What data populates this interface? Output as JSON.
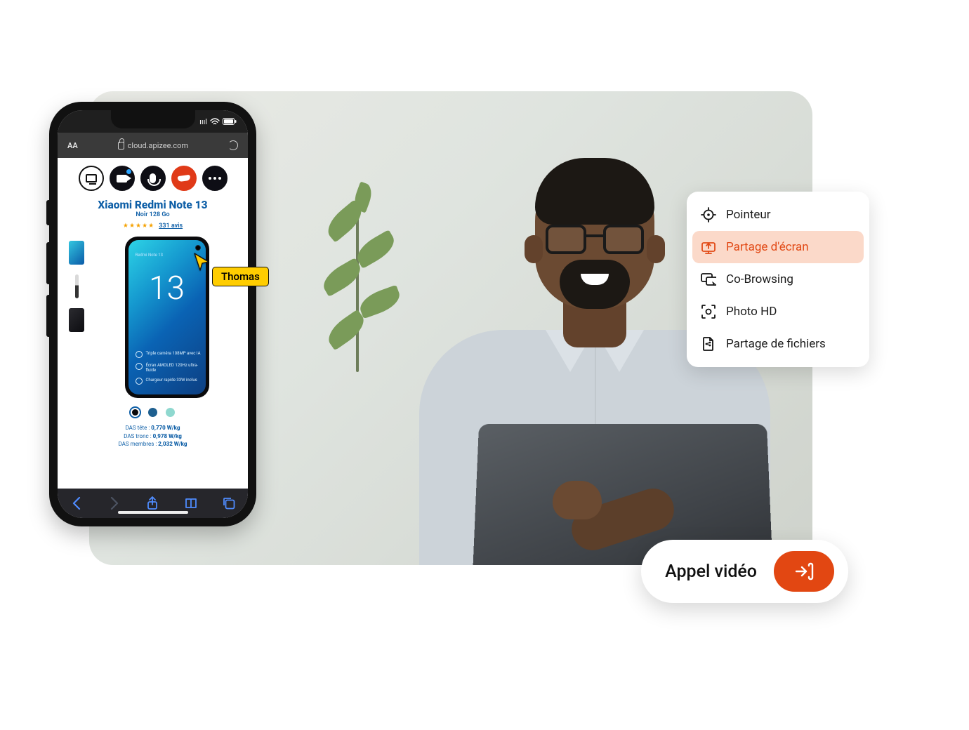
{
  "phone": {
    "status": {
      "signal": "ıııl",
      "wifi": "􀙇",
      "battery": "􀛨"
    },
    "address": {
      "aA": "AA",
      "url": "cloud.apizee.com"
    },
    "product": {
      "title": "Xiaomi Redmi Note 13",
      "subtitle": "Noir 128 Go",
      "reviews_link": "331 avis",
      "image_badge_mini": "Redmi Note 13",
      "image_badge_big": "13",
      "features": [
        "Triple caméra 108MP avec IA",
        "Écran AMOLED 120Hz ultra-fluide",
        "Chargeur rapide 33W inclus"
      ],
      "swatches": [
        {
          "color": "#0a0a0c",
          "selected": true
        },
        {
          "color": "#1e5f8f",
          "selected": false
        },
        {
          "color": "#8fd8cf",
          "selected": false
        }
      ],
      "das": [
        {
          "label": "DAS tête :",
          "value": "0,770 W/kg"
        },
        {
          "label": "DAS tronc :",
          "value": "0,978 W/kg"
        },
        {
          "label": "DAS membres :",
          "value": "2,032 W/kg"
        }
      ]
    }
  },
  "cursor_name": "Thomas",
  "menu": {
    "items": [
      {
        "key": "pointer",
        "label": "Pointeur",
        "active": false
      },
      {
        "key": "screen",
        "label": "Partage d'écran",
        "active": true
      },
      {
        "key": "cobrowse",
        "label": "Co-Browsing",
        "active": false
      },
      {
        "key": "photo",
        "label": "Photo HD",
        "active": false
      },
      {
        "key": "files",
        "label": "Partage de fichiers",
        "active": false
      }
    ]
  },
  "call_button": {
    "label": "Appel vidéo"
  },
  "colors": {
    "accent": "#e24712"
  }
}
